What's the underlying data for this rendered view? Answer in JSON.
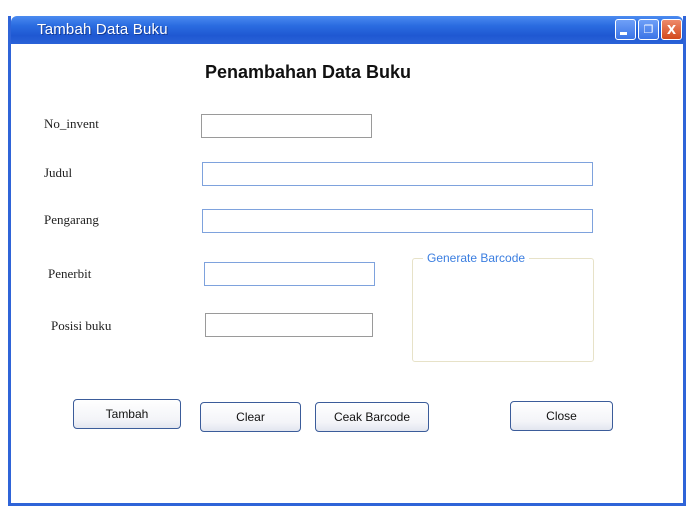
{
  "window": {
    "title": "Tambah Data Buku",
    "controls": {
      "minimize_icon": "minimize-icon",
      "maximize_icon": "restore-icon",
      "close_icon": "close-icon",
      "close_glyph": "X"
    }
  },
  "form": {
    "heading": "Penambahan Data Buku",
    "fields": {
      "no_invent": {
        "label": "No_invent",
        "value": ""
      },
      "judul": {
        "label": "Judul",
        "value": ""
      },
      "pengarang": {
        "label": "Pengarang",
        "value": ""
      },
      "penerbit": {
        "label": "Penerbit",
        "value": ""
      },
      "posisi_buku": {
        "label": "Posisi buku",
        "value": ""
      }
    },
    "barcode_group": {
      "legend": "Generate Barcode"
    },
    "buttons": {
      "tambah": "Tambah",
      "clear": "Clear",
      "ceak_barcode": "Ceak Barcode",
      "close": "Close"
    }
  },
  "colors": {
    "titlebar": "#2a63d8",
    "field_border": "#7ea2dd",
    "legend_text": "#3b7ee0"
  }
}
